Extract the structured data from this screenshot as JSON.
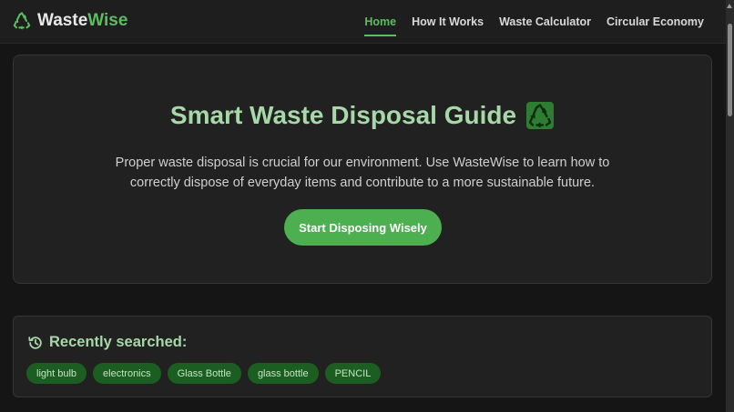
{
  "brand": {
    "name_part1": "Waste",
    "name_part2": "Wise",
    "icon": "recycle-icon"
  },
  "nav": {
    "links": [
      {
        "label": "Home",
        "active": true
      },
      {
        "label": "How It Works",
        "active": false
      },
      {
        "label": "Waste Calculator",
        "active": false
      },
      {
        "label": "Circular Economy",
        "active": false
      }
    ]
  },
  "hero": {
    "title": "Smart Waste Disposal Guide",
    "emoji_icon": "recycle-emoji-icon",
    "text": "Proper waste disposal is crucial for our environment. Use WasteWise to learn how to correctly dispose of everyday items and contribute to a more sustainable future.",
    "button_label": "Start Disposing Wisely"
  },
  "recent": {
    "title": "Recently searched:",
    "icon": "history-icon",
    "items": [
      "light bulb",
      "electronics",
      "Glass Bottle",
      "glass bottle",
      "PENCIL"
    ]
  },
  "colors": {
    "accent": "#4caf50",
    "accent_text": "#a6d8a8",
    "background": "#151515",
    "card": "#212121",
    "chip": "#1c5e22"
  }
}
